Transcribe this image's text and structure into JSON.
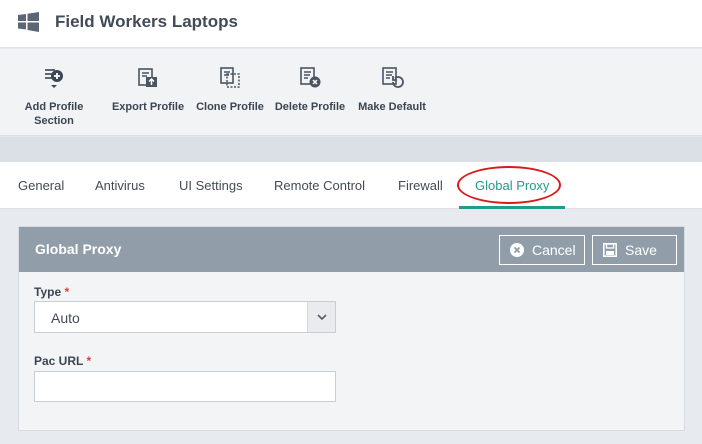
{
  "header": {
    "title": "Field Workers Laptops",
    "icon": "windows-logo-icon"
  },
  "toolbar": {
    "items": [
      {
        "label": "Add Profile Section",
        "icon": "add-section-icon"
      },
      {
        "label": "Export Profile",
        "icon": "export-icon"
      },
      {
        "label": "Clone Profile",
        "icon": "clone-icon"
      },
      {
        "label": "Delete Profile",
        "icon": "delete-icon"
      },
      {
        "label": "Make Default",
        "icon": "make-default-icon"
      }
    ]
  },
  "tabs": [
    {
      "label": "General"
    },
    {
      "label": "Antivirus"
    },
    {
      "label": "UI Settings"
    },
    {
      "label": "Remote Control"
    },
    {
      "label": "Firewall"
    },
    {
      "label": "Global Proxy"
    }
  ],
  "active_tab": "Global Proxy",
  "panel": {
    "title": "Global Proxy",
    "cancel_label": "Cancel",
    "save_label": "Save",
    "type_label": "Type",
    "type_required": "*",
    "type_value": "Auto",
    "pac_label": "Pac URL",
    "pac_required": "*",
    "pac_value": ""
  },
  "colors": {
    "accent": "#1e9e8a",
    "panel_header": "#919ea9",
    "highlight_oval": "#dc1a1a"
  }
}
